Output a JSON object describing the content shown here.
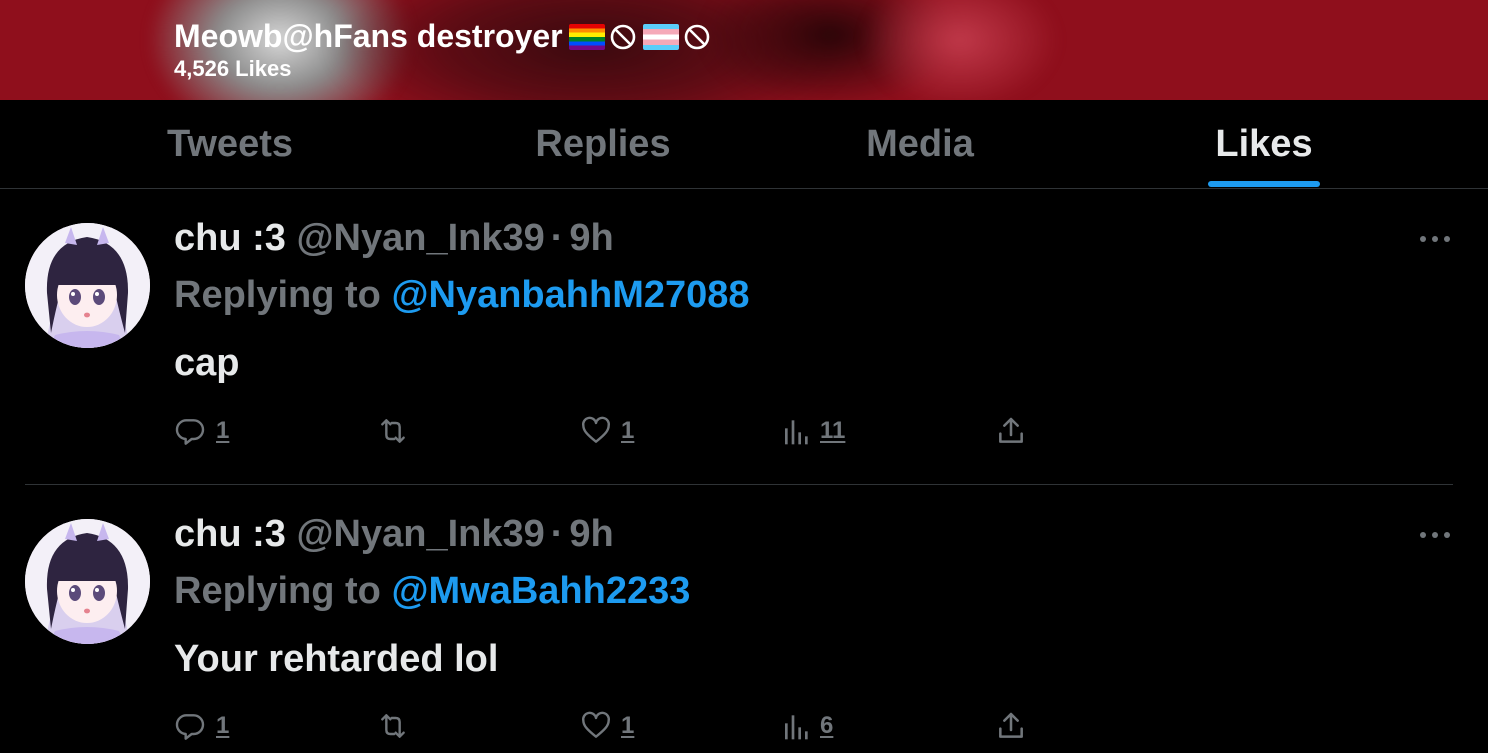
{
  "header": {
    "name": "Meowb@hFans destroyer",
    "likes_count": "4,526 Likes",
    "emoji_icons": [
      "rainbow-flag-icon",
      "prohibited-icon",
      "transgender-flag-icon",
      "prohibited-icon"
    ],
    "background_color": "#8f0f1c"
  },
  "tabs": [
    {
      "label": "Tweets",
      "active": false
    },
    {
      "label": "Replies",
      "active": false
    },
    {
      "label": "Media",
      "active": false
    },
    {
      "label": "Likes",
      "active": true
    }
  ],
  "accent_color": "#1d9bf0",
  "tweets": [
    {
      "display_name": "chu :3",
      "handle": "@Nyan_Ink39",
      "separator": "·",
      "time": "9h",
      "replying_prefix": "Replying to",
      "replying_to": "@NyanbahhM27088",
      "text": "cap",
      "replies": "1",
      "retweets": "",
      "likes": "1",
      "views": "11"
    },
    {
      "display_name": "chu :3",
      "handle": "@Nyan_Ink39",
      "separator": "·",
      "time": "9h",
      "replying_prefix": "Replying to",
      "replying_to": "@MwaBahh2233",
      "text": "Your rehtarded lol",
      "replies": "1",
      "retweets": "",
      "likes": "1",
      "views": "6"
    }
  ]
}
